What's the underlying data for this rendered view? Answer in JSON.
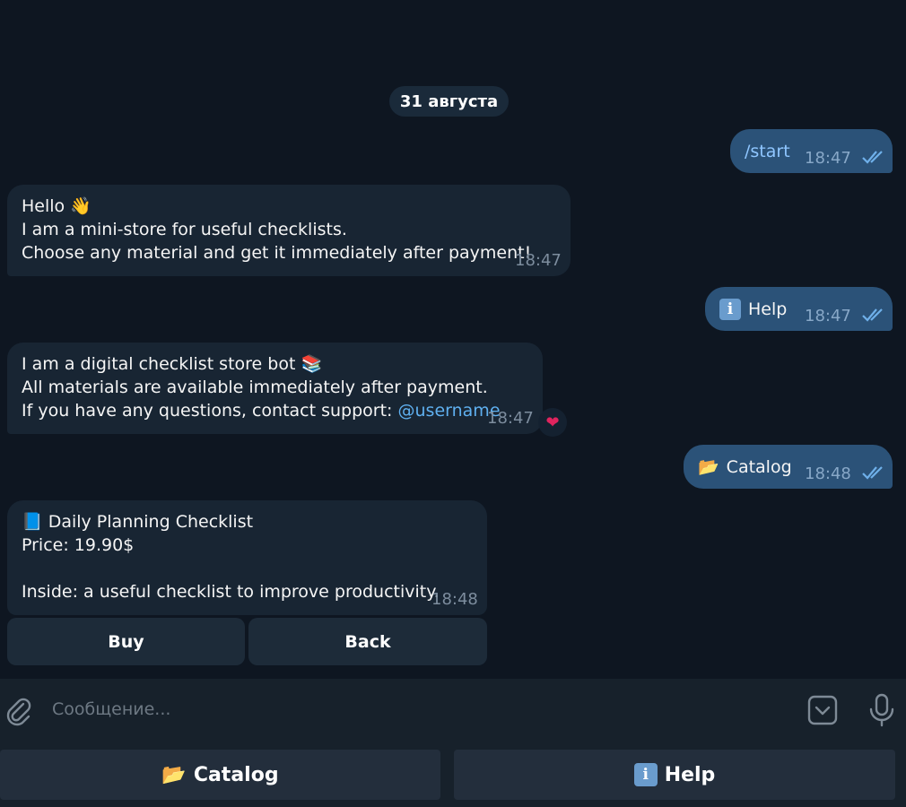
{
  "chat": {
    "date_label": "31 августа",
    "messages": [
      {
        "direction": "out",
        "text": "/start",
        "time": "18:47"
      },
      {
        "direction": "in",
        "lines": [
          "Hello 👋",
          "I am a mini-store for useful checklists.",
          "Choose any material and get it immediately after payment!"
        ],
        "time": "18:47"
      },
      {
        "direction": "out",
        "icon": "information-icon",
        "text": "Help",
        "time": "18:47"
      },
      {
        "direction": "in",
        "lines": [
          "I am a digital checklist store bot 📚",
          "All materials are available immediately after payment.",
          "If you have any questions, contact support: "
        ],
        "link": "@username",
        "time": "18:47",
        "reaction": "❤"
      },
      {
        "direction": "out",
        "icon": "folder-icon",
        "text": "Catalog",
        "time": "18:48"
      },
      {
        "direction": "in",
        "lines": [
          "📘 Daily Planning Checklist",
          "Price: 19.90$",
          "",
          "Inside: a useful checklist to improve productivity."
        ],
        "time": "18:48"
      }
    ],
    "inline_buttons": [
      "Buy",
      "Back"
    ]
  },
  "composer": {
    "placeholder": "Сообщение..."
  },
  "reply_keyboard": [
    {
      "icon": "folder-icon",
      "label": "Catalog"
    },
    {
      "icon": "information-icon",
      "label": "Help"
    }
  ],
  "colors": {
    "background": "#0e1621",
    "incoming_bubble": "#182533",
    "outgoing_bubble": "#2b5278",
    "link": "#5fb0f0",
    "composer": "#17212b"
  }
}
